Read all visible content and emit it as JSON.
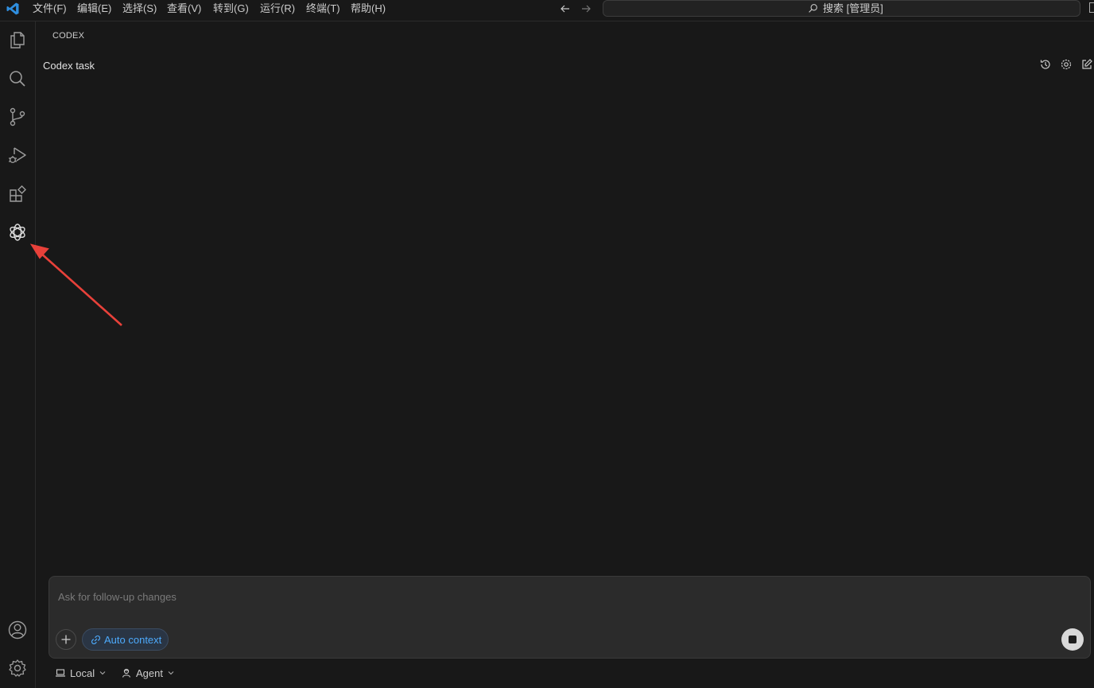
{
  "menu": [
    "文件(F)",
    "编辑(E)",
    "选择(S)",
    "查看(V)",
    "转到(G)",
    "运行(R)",
    "终端(T)",
    "帮助(H)"
  ],
  "search": {
    "text": "搜索 [管理员]"
  },
  "panel": {
    "title": "CODEX",
    "task_title": "Codex task"
  },
  "composer": {
    "placeholder": "Ask for follow-up changes",
    "context_chip": "Auto context"
  },
  "footer": {
    "mode": "Local",
    "agent": "Agent"
  },
  "colors": {
    "background": "#181818",
    "accent": "#4daafc",
    "arrow": "#e8413a"
  },
  "icons": [
    "explorer-icon",
    "search-icon",
    "source-control-icon",
    "run-debug-icon",
    "extensions-icon",
    "openai-icon",
    "account-icon",
    "settings-gear-icon"
  ]
}
